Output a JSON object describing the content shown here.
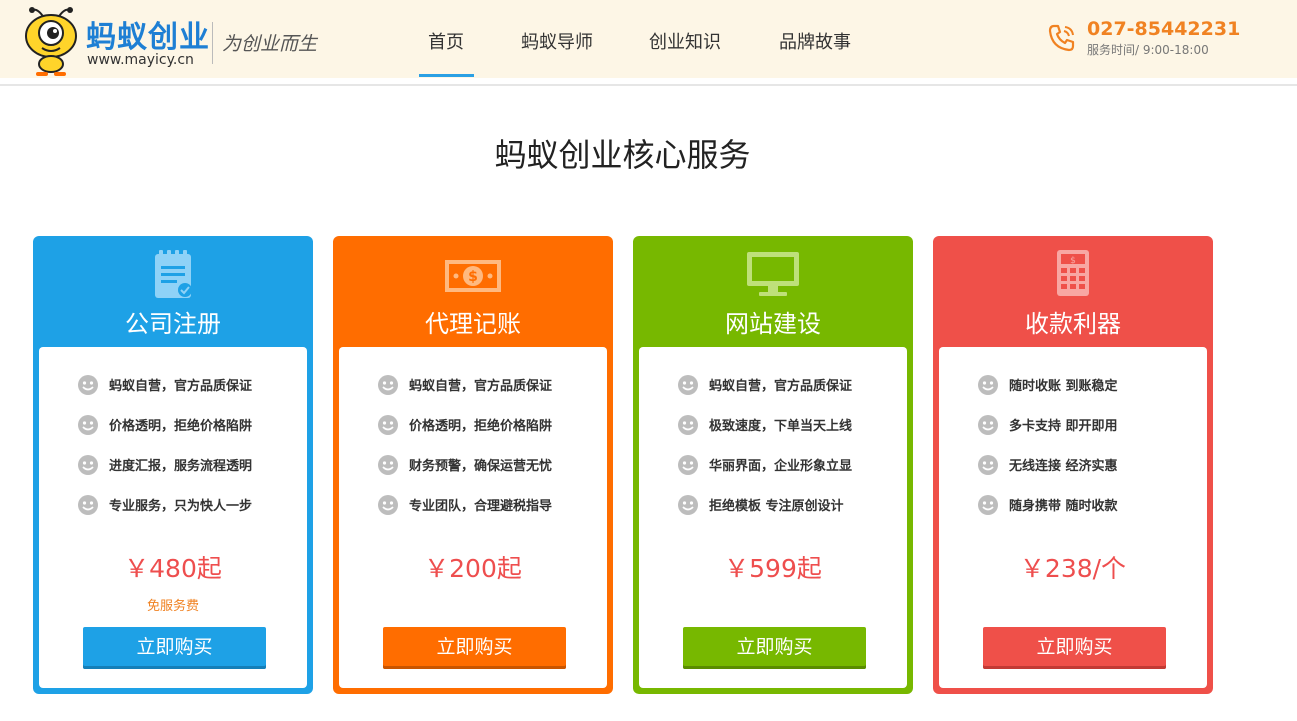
{
  "header": {
    "logo_name": "蚂蚁创业",
    "logo_url": "www.mayicy.cn",
    "slogan": "为创业而生",
    "nav": [
      "首页",
      "蚂蚁导师",
      "创业知识",
      "品牌故事"
    ],
    "active_nav": "首页",
    "phone": "027-85442231",
    "hours": "服务时间/ 9:00-18:00"
  },
  "section_title": "蚂蚁创业核心服务",
  "cards": [
    {
      "title": "公司注册",
      "icon": "clipboard-icon",
      "color": "#1ea1e6",
      "button_color": "#1ea1e6",
      "features": [
        "蚂蚁自营，官方品质保证",
        "价格透明，拒绝价格陷阱",
        "进度汇报，服务流程透明",
        "专业服务，只为快人一步"
      ],
      "price": "￥480起",
      "note": "免服务费",
      "button": "立即购买"
    },
    {
      "title": "代理记账",
      "icon": "money-icon",
      "color": "#ff6d00",
      "button_color": "#ff6d00",
      "features": [
        "蚂蚁自营，官方品质保证",
        "价格透明，拒绝价格陷阱",
        "财务预警，确保运营无忧",
        "专业团队，合理避税指导"
      ],
      "price": "￥200起",
      "note": "",
      "button": "立即购买"
    },
    {
      "title": "网站建设",
      "icon": "monitor-icon",
      "color": "#77b800",
      "button_color": "#77b800",
      "features": [
        "蚂蚁自营，官方品质保证",
        "极致速度，下单当天上线",
        "华丽界面，企业形象立显",
        "拒绝模板 专注原创设计"
      ],
      "price": "￥599起",
      "note": "",
      "button": "立即购买"
    },
    {
      "title": "收款利器",
      "icon": "calculator-icon",
      "color": "#ef5049",
      "button_color": "#ef5049",
      "features": [
        "随时收账 到账稳定",
        "多卡支持 即开即用",
        "无线连接 经济实惠",
        "随身携带 随时收款"
      ],
      "price": "￥238/个",
      "note": "",
      "button": "立即购买"
    }
  ]
}
